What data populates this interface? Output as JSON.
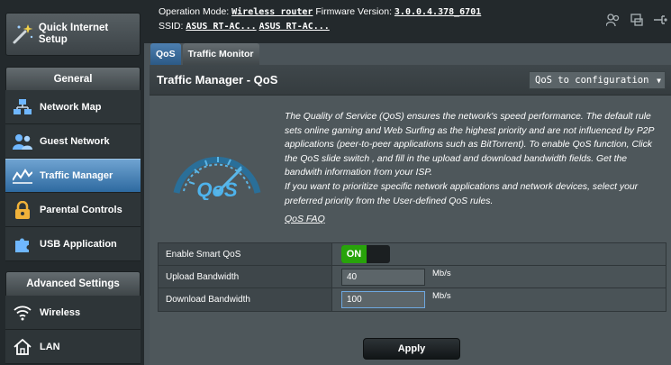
{
  "sidebar": {
    "quick_setup": "Quick Internet Setup",
    "general_header": "General",
    "general_items": [
      {
        "label": "Network Map",
        "icon": "network-map-icon"
      },
      {
        "label": "Guest Network",
        "icon": "guest-network-icon"
      },
      {
        "label": "Traffic Manager",
        "icon": "traffic-manager-icon",
        "active": true
      },
      {
        "label": "Parental Controls",
        "icon": "lock-icon"
      },
      {
        "label": "USB Application",
        "icon": "puzzle-icon"
      }
    ],
    "advanced_header": "Advanced Settings",
    "advanced_items": [
      {
        "label": "Wireless",
        "icon": "wifi-icon"
      },
      {
        "label": "LAN",
        "icon": "home-icon"
      }
    ]
  },
  "header": {
    "operation_mode_label": "Operation Mode:",
    "operation_mode_value": "Wireless router",
    "firmware_label": "Firmware Version:",
    "firmware_value": "3.0.0.4.378_6701",
    "ssid_label": "SSID:",
    "ssid_values": [
      "ASUS RT-AC...",
      "ASUS RT-AC..."
    ]
  },
  "tabs": [
    {
      "label": "QoS",
      "active": true
    },
    {
      "label": "Traffic Monitor",
      "active": false
    }
  ],
  "main": {
    "title": "Traffic Manager - QoS",
    "select_value": "QoS to configuration",
    "description": "The Quality of Service (QoS) ensures the network's speed performance. The default rule sets online gaming and Web Surfing as the highest priority and are not influenced by P2P applications (peer-to-peer applications such as BitTorrent). To enable QoS function, Click the QoS slide switch , and fill in the upload and download bandwidth fields. Get the bandwith information from your ISP.",
    "description2": "If you want to prioritize specific network applications and network devices, select your preferred priority from the User-defined QoS rules.",
    "faq_link": "QoS FAQ",
    "gauge_text": "QoS",
    "rows": {
      "smart_qos_label": "Enable Smart QoS",
      "smart_qos_state": "ON",
      "upload_label": "Upload Bandwidth",
      "upload_value": "40",
      "upload_unit": "Mb/s",
      "download_label": "Download Bandwidth",
      "download_value": "100",
      "download_unit": "Mb/s"
    },
    "apply_label": "Apply"
  },
  "colors": {
    "accent_blue": "#2e6aa0",
    "toggle_on": "#28a30a",
    "panel_bg": "#4e575b",
    "sidebar_bg": "#23292c"
  }
}
